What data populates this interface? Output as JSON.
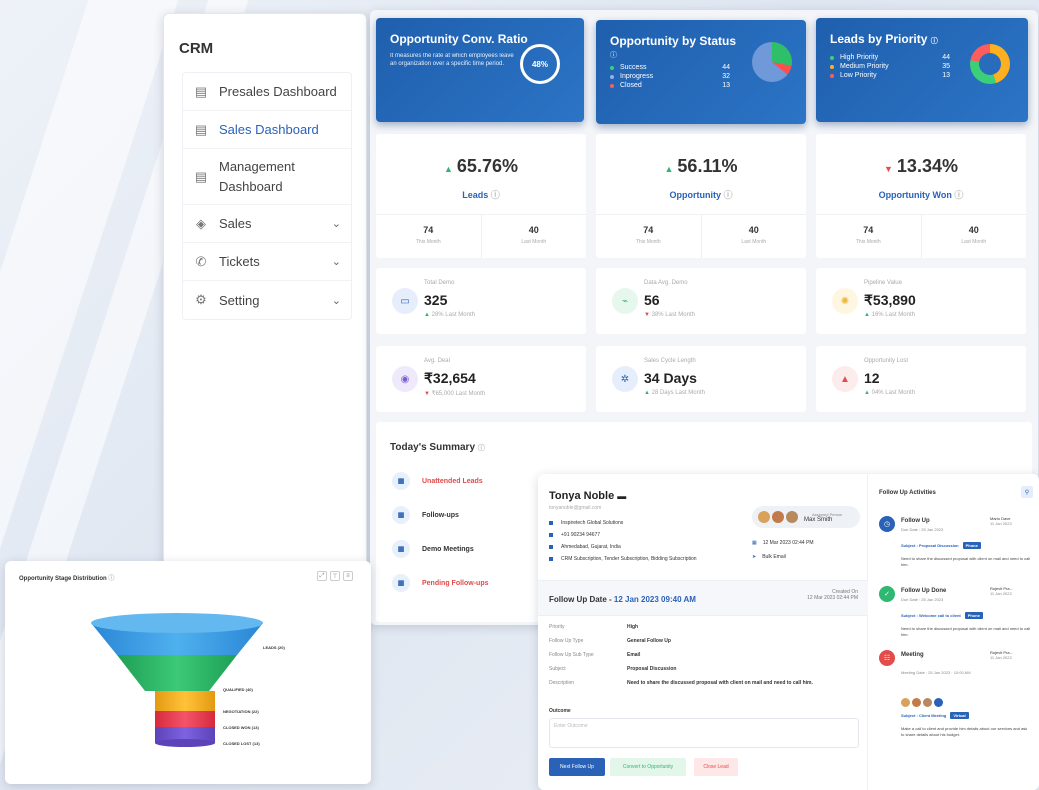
{
  "colors": {
    "accent": "#2a62b8",
    "card_blue": "#2368b8",
    "positive": "#2eb872",
    "negative": "#e44b4b"
  },
  "sidebar": {
    "title": "CRM",
    "items": [
      {
        "label": "Presales Dashboard",
        "icon": "dashboard-icon"
      },
      {
        "label": "Sales Dashboard",
        "icon": "dashboard-icon"
      },
      {
        "label": "Management Dashboard",
        "icon": "dashboard-icon"
      },
      {
        "label": "Sales",
        "icon": "tag-icon"
      },
      {
        "label": "Tickets",
        "icon": "ticket-icon"
      },
      {
        "label": "Setting",
        "icon": "settings-icon"
      }
    ]
  },
  "top_cards": {
    "conv": {
      "title": "Opportunity Conv. Ratio",
      "desc": "It measures the rate at which employees leave an organization over a specific time period.",
      "value": "48%"
    },
    "status": {
      "title": "Opportunity by Status",
      "rows": [
        {
          "label": "Success",
          "value": "44"
        },
        {
          "label": "Inprogress",
          "value": "32"
        },
        {
          "label": "Closed",
          "value": "13"
        }
      ]
    },
    "priority": {
      "title": "Leads by Priority",
      "rows": [
        {
          "label": "High Priority",
          "value": "44"
        },
        {
          "label": "Medium Priority",
          "value": "35"
        },
        {
          "label": "Low Priority",
          "value": "13"
        }
      ]
    }
  },
  "kpis": [
    {
      "pct": "65.76%",
      "label": "Leads",
      "this": "74",
      "this_l": "This Month",
      "last": "40",
      "last_l": "Last Month"
    },
    {
      "pct": "56.11%",
      "label": "Opportunity",
      "this": "74",
      "this_l": "This Month",
      "last": "40",
      "last_l": "Last Month"
    },
    {
      "pct": "13.34%",
      "label": "Opportunity Won",
      "this": "74",
      "this_l": "This Month",
      "last": "40",
      "last_l": "Last Month"
    }
  ],
  "metrics": [
    {
      "title": "Total Demo",
      "value": "325",
      "sub": "28% Last Month"
    },
    {
      "title": "Data Avg. Demo",
      "value": "56",
      "sub": "38% Last Month"
    },
    {
      "title": "Pipeline Value",
      "value": "₹53,890",
      "sub": "16% Last Month"
    },
    {
      "title": "Avg. Deal",
      "value": "₹32,654",
      "sub": "₹65,000 Last Month"
    },
    {
      "title": "Sales Cycle Length",
      "value": "34 Days",
      "sub": "28 Days Last Month"
    },
    {
      "title": "Opportunity Lost",
      "value": "12",
      "sub": "04% Last Month"
    }
  ],
  "summary": {
    "title": "Today's Summary",
    "items": [
      "Unattended Leads",
      "Follow-ups",
      "Demo Meetings",
      "Pending Follow-ups"
    ]
  },
  "funnel": {
    "title": "Opportunity Stage Distribution",
    "labels": [
      "LEADS (20)",
      "QUALIFIED (40)",
      "NEGOTIATION (22)",
      "CLOSED WON (13)",
      "CLOSED LOST (13)"
    ]
  },
  "detail": {
    "name": "Tonya Noble",
    "email": "tonyanoble@gmail.com",
    "info": [
      "Inspiretech Global Solutions",
      "+91 90234 94677",
      "Ahmedabad, Gujarat, India",
      "CRM Subscription, Tender Subscription, Bidding Subscription"
    ],
    "assigned_label": "Assigned Person",
    "assigned_name": "Max Smith",
    "meta": [
      "12 Mar 2023 02:44 PM",
      "Bulk Email"
    ],
    "followup_label": "Follow Up Date -",
    "followup_date": "12 Jan 2023 09:40 AM",
    "created_label": "Created On",
    "created_date": "12 Mar 2023 02:44 PM",
    "fields": [
      {
        "k": "Priority",
        "v": "High"
      },
      {
        "k": "Follow Up Type",
        "v": "General Follow Up"
      },
      {
        "k": "Follow Up Sub Type",
        "v": "Email"
      },
      {
        "k": "Subject",
        "v": "Proposal Discussion"
      },
      {
        "k": "Description",
        "v": "Need to share the discussed proposal with client on mail and need to call him."
      }
    ],
    "outcome_label": "Outcome",
    "outcome_placeholder": "Enter Outcome",
    "buttons": {
      "next": "Next Follow Up",
      "convert": "Convert to Opportunity",
      "close": "Close Lead"
    }
  },
  "activities": {
    "title": "Follow Up Activities",
    "items": [
      {
        "title": "Follow Up",
        "due": "Due Date : 25 Jan 2023",
        "person": "Mario Dave",
        "pdate": "11 Jan 2023",
        "subject": "Subject : Proposal Discussion",
        "tag": "Phone",
        "desc": "Need to share the discussed proposal with client on mail and need to call him."
      },
      {
        "title": "Follow Up Done",
        "due": "Due Date : 25 Jan 2023",
        "person": "Rujevit Pra...",
        "pdate": "11 Jan 2023",
        "subject": "Subject : Welcome call to client",
        "tag": "Phone",
        "desc": "Need to share the discussed proposal with client on mail and need to call him."
      },
      {
        "title": "Meeting",
        "due": "Meeting Date : 25 Jan 2023 · 10:00 AM",
        "person": "Rujevit Pra...",
        "pdate": "11 Jan 2023",
        "subject": "Subject : Client Meeting",
        "tag": "Virtual",
        "desc": "Make a call to client and provide him details about our services and ask to share details about his budget."
      }
    ]
  }
}
